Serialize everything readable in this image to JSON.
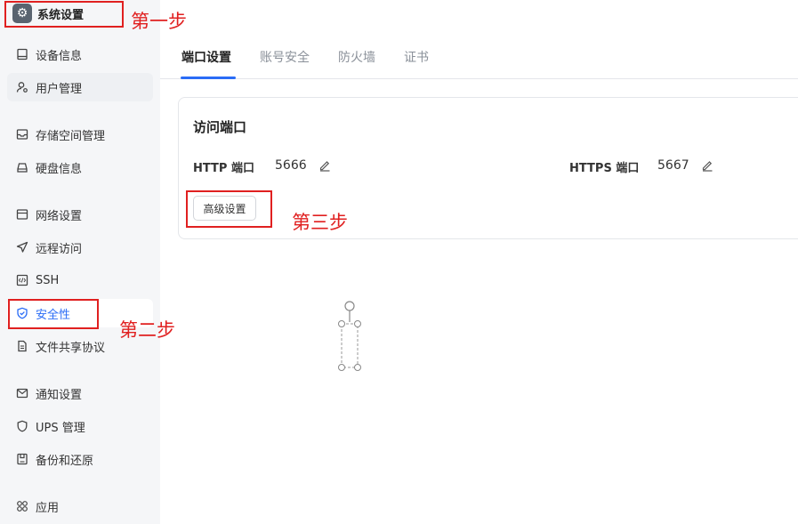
{
  "app": {
    "title": "系统设置",
    "icon": "gear-icon"
  },
  "sidebar": {
    "items": [
      {
        "label": "设备信息",
        "icon": "device-icon"
      },
      {
        "label": "用户管理",
        "icon": "user-icon"
      },
      {
        "label": "存储空间管理",
        "icon": "storage-icon"
      },
      {
        "label": "硬盘信息",
        "icon": "disk-icon"
      },
      {
        "label": "网络设置",
        "icon": "network-icon"
      },
      {
        "label": "远程访问",
        "icon": "send-icon"
      },
      {
        "label": "SSH",
        "icon": "code-icon"
      },
      {
        "label": "安全性",
        "icon": "shield-check-icon"
      },
      {
        "label": "文件共享协议",
        "icon": "file-icon"
      },
      {
        "label": "通知设置",
        "icon": "mail-icon"
      },
      {
        "label": "UPS 管理",
        "icon": "ups-icon"
      },
      {
        "label": "备份和还原",
        "icon": "backup-icon"
      },
      {
        "label": "应用",
        "icon": "apps-icon"
      }
    ],
    "active": "安全性"
  },
  "tabs": [
    {
      "label": "端口设置"
    },
    {
      "label": "账号安全"
    },
    {
      "label": "防火墙"
    },
    {
      "label": "证书"
    }
  ],
  "active_tab": "端口设置",
  "card": {
    "title": "访问端口",
    "http_label": "HTTP 端口",
    "http_port": "5666",
    "https_label": "HTTPS 端口",
    "https_port": "5667",
    "advanced_button": "高级设置"
  },
  "annotations": {
    "step1": "第一步",
    "step2": "第二步",
    "step3": "第三步",
    "color": "#e02020"
  },
  "colors": {
    "accent": "#2a6cf6",
    "sidebar_bg": "#f5f6f8"
  }
}
